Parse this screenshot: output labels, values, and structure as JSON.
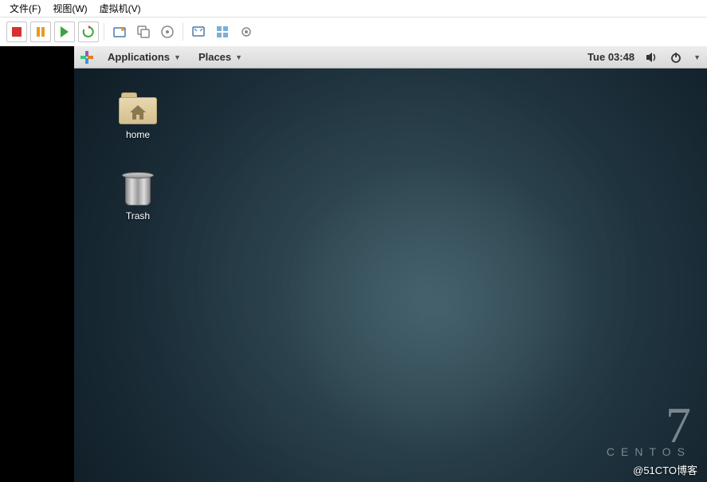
{
  "host": {
    "menu": {
      "file": "文件(F)",
      "view": "视图(W)",
      "vm": "虚拟机(V)"
    },
    "toolbar": {
      "stop": "stop",
      "pause": "pause",
      "play": "play",
      "restart": "restart",
      "snapshot": "snapshot",
      "snapshot_mgr": "snapshot-manager",
      "device_cd": "device-cd",
      "fullscreen": "fullscreen",
      "unity": "unity",
      "settings": "settings"
    }
  },
  "guest": {
    "topbar": {
      "applications": "Applications",
      "places": "Places",
      "datetime": "Tue 03:48"
    },
    "desktop": {
      "icons": [
        {
          "name": "home",
          "label": "home"
        },
        {
          "name": "trash",
          "label": "Trash"
        }
      ]
    },
    "brand": {
      "version": "7",
      "name": "CENTOS"
    }
  },
  "watermark": "@51CTO博客"
}
